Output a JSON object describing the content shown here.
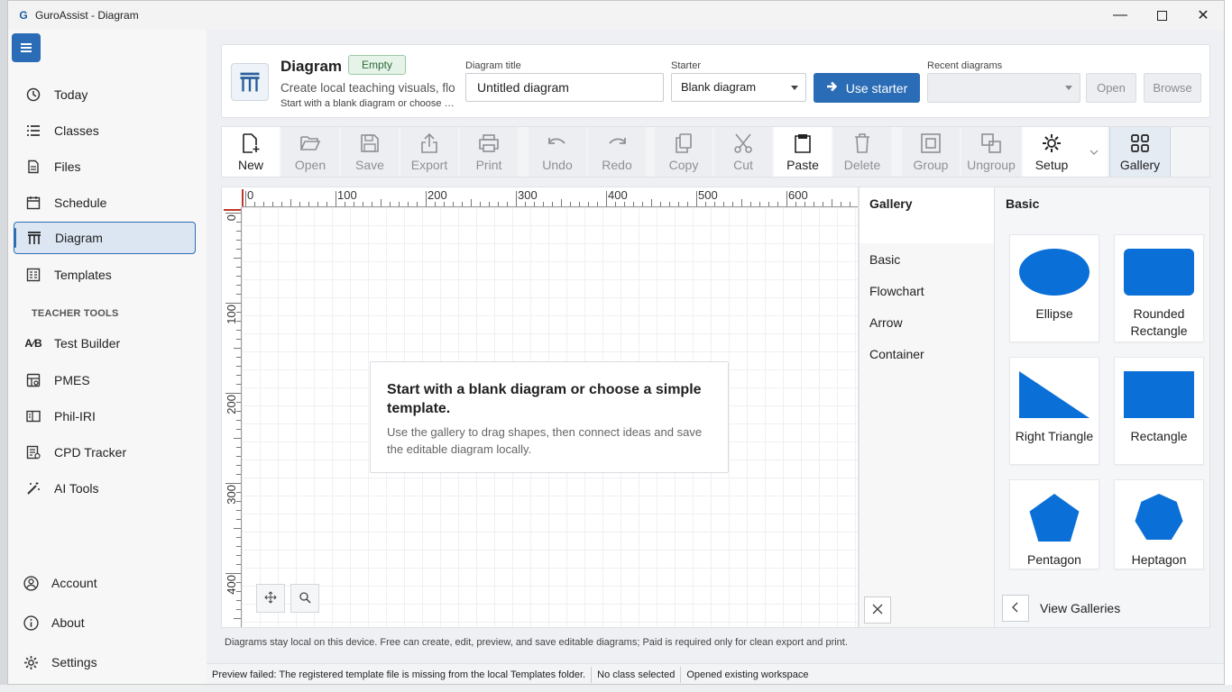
{
  "window": {
    "app_title": "GuroAssist - Diagram",
    "logo": "G",
    "min_icon": "minimize-icon",
    "max_icon": "maximize-icon",
    "close_icon": "close-icon"
  },
  "sidebar": {
    "menu_icon": "hamburger-menu-icon",
    "items": [
      {
        "label": "Today",
        "icon": "clock-icon"
      },
      {
        "label": "Classes",
        "icon": "list-icon"
      },
      {
        "label": "Files",
        "icon": "document-icon"
      },
      {
        "label": "Schedule",
        "icon": "calendar-icon"
      },
      {
        "label": "Diagram",
        "icon": "diagram-icon",
        "selected": true
      },
      {
        "label": "Templates",
        "icon": "template-icon"
      }
    ],
    "section_label": "TEACHER TOOLS",
    "tools": [
      {
        "label": "Test Builder",
        "icon": "ab-icon"
      },
      {
        "label": "PMES",
        "icon": "chart-doc-icon"
      },
      {
        "label": "Phil-IRI",
        "icon": "book-icon"
      },
      {
        "label": "CPD Tracker",
        "icon": "tracker-icon"
      },
      {
        "label": "AI Tools",
        "icon": "magic-wand-icon"
      }
    ],
    "bottom": [
      {
        "label": "Account",
        "icon": "account-icon"
      },
      {
        "label": "About",
        "icon": "info-icon"
      },
      {
        "label": "Settings",
        "icon": "gear-icon"
      }
    ]
  },
  "header": {
    "title": "Diagram",
    "badge": "Empty",
    "subtitle": "Create local teaching visuals, flo",
    "subtitle2": "Start with a blank diagram or choose a simple template.",
    "title_field_label": "Diagram title",
    "title_field_value": "Untitled diagram",
    "starter_label": "Starter",
    "starter_value": "Blank diagram",
    "use_starter": "Use starter",
    "recent_label": "Recent diagrams",
    "recent_value": "",
    "open": "Open",
    "browse": "Browse"
  },
  "toolbar": {
    "new": "New",
    "open": "Open",
    "save": "Save",
    "export": "Export",
    "print": "Print",
    "undo": "Undo",
    "redo": "Redo",
    "copy": "Copy",
    "cut": "Cut",
    "paste": "Paste",
    "delete": "Delete",
    "group": "Group",
    "ungroup": "Ungroup",
    "setup": "Setup",
    "gallery": "Gallery"
  },
  "canvas": {
    "ruler_x": [
      "0",
      "100",
      "200",
      "300",
      "400",
      "500",
      "600"
    ],
    "ruler_y": [
      "0",
      "100",
      "200",
      "300",
      "400"
    ],
    "hint_title": "Start with a blank diagram or choose a simple template.",
    "hint_body": "Use the gallery to drag shapes, then connect ideas and save the editable diagram locally."
  },
  "gallery": {
    "header": "Gallery",
    "categories": [
      "Basic",
      "Flowchart",
      "Arrow",
      "Container"
    ],
    "section_title": "Basic",
    "shapes": [
      "Ellipse",
      "Rounded Rectangle",
      "Right Triangle",
      "Rectangle",
      "Pentagon",
      "Heptagon"
    ],
    "view_galleries": "View Galleries",
    "shape_color": "#0a6fd6"
  },
  "footnote": "Diagrams stay local on this device. Free can create, edit, preview, and save editable diagrams; Paid is required only for clean export and print.",
  "status": {
    "message": "Preview failed: The registered template file is missing from the local Templates folder.",
    "class": "No class selected",
    "workspace": "Opened existing workspace"
  },
  "colors": {
    "accent": "#2a6cb5",
    "shape": "#0a6fd6"
  }
}
